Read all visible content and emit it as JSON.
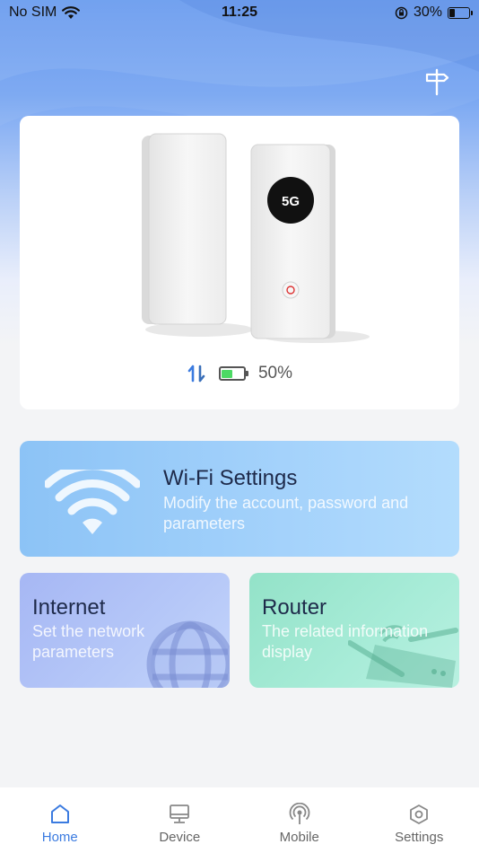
{
  "status_bar": {
    "carrier": "No SIM",
    "time": "11:25",
    "battery_percent": "30%"
  },
  "device": {
    "screen_label": "5G",
    "battery_percent": "50%",
    "battery_level": 0.5
  },
  "cards": {
    "wifi": {
      "title": "Wi-Fi Settings",
      "desc": "Modify the account, password and parameters"
    },
    "internet": {
      "title": "Internet",
      "desc": "Set the network parameters"
    },
    "router": {
      "title": "Router",
      "desc": "The related information display"
    }
  },
  "tabs": [
    {
      "label": "Home",
      "icon": "home-icon",
      "active": true
    },
    {
      "label": "Device",
      "icon": "monitor-icon",
      "active": false
    },
    {
      "label": "Mobile",
      "icon": "antenna-icon",
      "active": false
    },
    {
      "label": "Settings",
      "icon": "hexagon-settings-icon",
      "active": false
    }
  ],
  "colors": {
    "accent": "#3b7be0",
    "battery_green": "#4cd964"
  }
}
